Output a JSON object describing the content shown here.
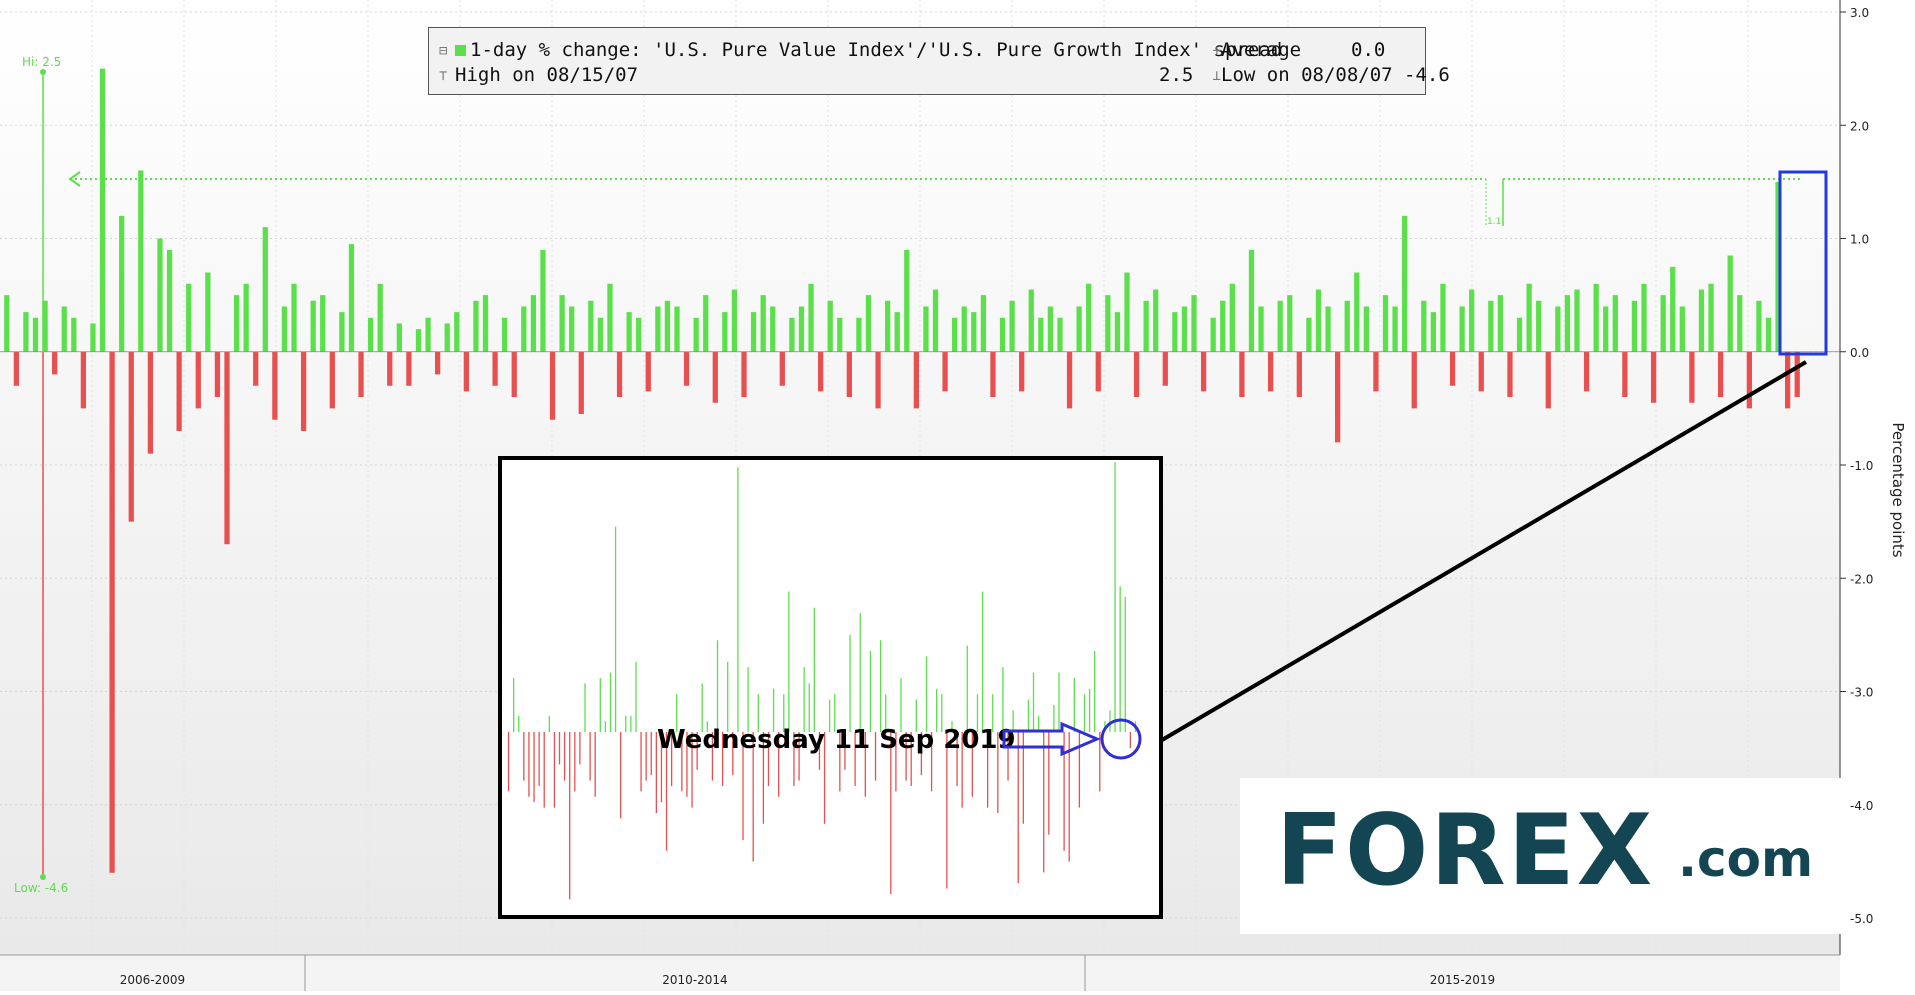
{
  "legend": {
    "series_label": "1-day % change: 'U.S. Pure Value Index'/'U.S. Pure Growth Index' spread",
    "average_label": "Average",
    "average_value": "0.0",
    "high_label": "High on 08/15/07",
    "high_value": "2.5",
    "low_label": "Low on 08/08/07",
    "low_value": "-4.6"
  },
  "annotations": {
    "hi_marker": "Hi: 2.5",
    "low_marker": "Low: -4.6",
    "callout_text": "Wednesday 11 Sep 2019",
    "small_label": "1.1"
  },
  "logo": {
    "main": "FOREX",
    "suffix": ".com"
  },
  "colors": {
    "positive": "#5be04c",
    "negative": "#e8504f",
    "highlight_box": "#2438e0",
    "callout": "#2f2fd6",
    "brand": "#134553",
    "zoom_frame": "#000000"
  },
  "chart_data": {
    "type": "bar",
    "title": "",
    "xlabel": "",
    "ylabel": "Percentage points",
    "ylim": [
      -5.3,
      3.1
    ],
    "yticks": [
      "3.0",
      "2.0",
      "1.0",
      "0.0",
      "-1.0",
      "-2.0",
      "-3.0",
      "-4.0",
      "-5.0"
    ],
    "ytick_values": [
      3,
      2,
      1,
      0,
      -1,
      -2,
      -3,
      -4,
      -5
    ],
    "x_periods": [
      "2006-2009",
      "2010-2014",
      "2015-2019"
    ],
    "grid": true,
    "series": [
      {
        "values": [
          0.5,
          -0.3,
          0.35,
          0.3,
          0.45,
          -0.2,
          0.4,
          0.3,
          -0.5,
          0.25,
          2.5,
          -4.6,
          1.2,
          -1.5,
          1.6,
          -0.9,
          1.0,
          0.9,
          -0.7,
          0.6,
          -0.5,
          0.7,
          -0.4,
          -1.7,
          0.5,
          0.6,
          -0.3,
          1.1,
          -0.6,
          0.4,
          0.6,
          -0.7,
          0.45,
          0.5,
          -0.5,
          0.35,
          0.95,
          -0.4,
          0.3,
          0.6,
          -0.3,
          0.25,
          -0.3,
          0.2,
          0.3,
          -0.2,
          0.25,
          0.35,
          -0.35,
          0.45,
          0.5,
          -0.3,
          0.3,
          -0.4,
          0.4,
          0.5,
          0.9,
          -0.6,
          0.5,
          0.4,
          -0.55,
          0.45,
          0.3,
          0.6,
          -0.4,
          0.35,
          0.3,
          -0.35,
          0.4,
          0.45,
          0.4,
          -0.3,
          0.3,
          0.5,
          -0.45,
          0.35,
          0.55,
          -0.4,
          0.35,
          0.5,
          0.4,
          -0.3,
          0.3,
          0.4,
          0.6,
          -0.35,
          0.45,
          0.3,
          -0.4,
          0.3,
          0.5,
          -0.5,
          0.45,
          0.35,
          0.9,
          -0.5,
          0.4,
          0.55,
          -0.35,
          0.3,
          0.4,
          0.35,
          0.5,
          -0.4,
          0.3,
          0.45,
          -0.35,
          0.55,
          0.3,
          0.4,
          0.3,
          -0.5,
          0.4,
          0.6,
          -0.35,
          0.5,
          0.35,
          0.7,
          -0.4,
          0.45,
          0.55,
          -0.3,
          0.35,
          0.4,
          0.5,
          -0.35,
          0.3,
          0.45,
          0.6,
          -0.4,
          0.9,
          0.4,
          -0.35,
          0.45,
          0.5,
          -0.4,
          0.3,
          0.55,
          0.4,
          -0.8,
          0.45,
          0.7,
          0.4,
          -0.35,
          0.5,
          0.4,
          1.2,
          -0.5,
          0.45,
          0.35,
          0.6,
          -0.3,
          0.4,
          0.55,
          -0.35,
          0.45,
          0.5,
          -0.4,
          0.3,
          0.6,
          0.45,
          -0.5,
          0.4,
          0.5,
          0.55,
          -0.35,
          0.6,
          0.4,
          0.5,
          -0.4,
          0.45,
          0.6,
          -0.45,
          0.5,
          0.75,
          0.4,
          -0.45,
          0.55,
          0.6,
          -0.4,
          0.85,
          0.5,
          -0.5,
          0.45,
          0.3,
          1.5,
          -0.5,
          -0.4
        ]
      }
    ],
    "inset_series": {
      "values": [
        -0.55,
        0.5,
        0.15,
        -0.45,
        -0.6,
        -0.65,
        -0.5,
        -0.7,
        0.15,
        -0.7,
        -0.3,
        -0.45,
        -1.55,
        -0.55,
        -0.3,
        0.45,
        -0.45,
        -0.6,
        0.5,
        0.1,
        0.55,
        1.9,
        -0.8,
        0.15,
        0.15,
        0.65,
        -0.55,
        -0.45,
        -0.4,
        -0.75,
        -0.65,
        -1.1,
        -0.5,
        0.35,
        -0.55,
        -0.6,
        -0.7,
        -0.35,
        0.45,
        0.1,
        -0.45,
        0.85,
        -0.5,
        0.65,
        -0.4,
        2.45,
        -1.0,
        0.6,
        -1.2,
        0.35,
        -0.85,
        -0.5,
        0.4,
        -0.6,
        0.35,
        1.3,
        -0.5,
        -0.45,
        0.6,
        0.45,
        1.15,
        -0.35,
        -0.85,
        0.3,
        0.35,
        -0.55,
        -0.35,
        0.9,
        -0.5,
        1.1,
        -0.6,
        0.75,
        -0.45,
        0.85,
        0.35,
        -1.5,
        -0.55,
        0.5,
        -0.45,
        -0.5,
        0.3,
        -0.4,
        0.7,
        -0.55,
        0.4,
        0.35,
        -1.45,
        0.1,
        -0.5,
        -0.7,
        0.8,
        -0.6,
        0.35,
        1.3,
        -0.7,
        0.35,
        -0.75,
        0.6,
        -0.45,
        0.2,
        -1.4,
        -0.85,
        0.3,
        0.55,
        0.15,
        -1.3,
        -0.95,
        0.25,
        0.55,
        -1.1,
        -1.2,
        0.5,
        -0.7,
        0.35,
        0.4,
        0.75,
        -0.55,
        0.1,
        0.2,
        2.5,
        1.35,
        1.25,
        -0.15,
        0.1
      ]
    }
  }
}
